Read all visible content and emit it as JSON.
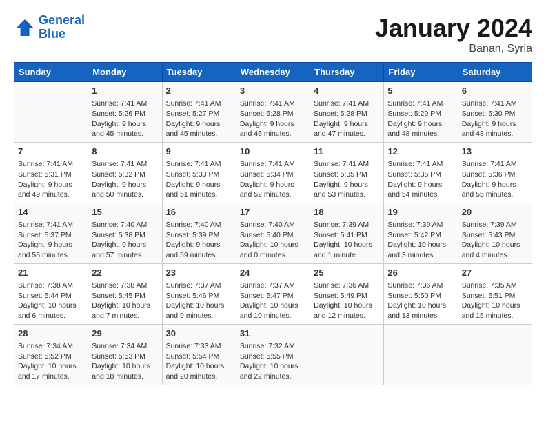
{
  "header": {
    "logo_line1": "General",
    "logo_line2": "Blue",
    "month": "January 2024",
    "location": "Banan, Syria"
  },
  "weekdays": [
    "Sunday",
    "Monday",
    "Tuesday",
    "Wednesday",
    "Thursday",
    "Friday",
    "Saturday"
  ],
  "weeks": [
    [
      {
        "day": "",
        "info": ""
      },
      {
        "day": "1",
        "info": "Sunrise: 7:41 AM\nSunset: 5:26 PM\nDaylight: 9 hours\nand 45 minutes."
      },
      {
        "day": "2",
        "info": "Sunrise: 7:41 AM\nSunset: 5:27 PM\nDaylight: 9 hours\nand 45 minutes."
      },
      {
        "day": "3",
        "info": "Sunrise: 7:41 AM\nSunset: 5:28 PM\nDaylight: 9 hours\nand 46 minutes."
      },
      {
        "day": "4",
        "info": "Sunrise: 7:41 AM\nSunset: 5:28 PM\nDaylight: 9 hours\nand 47 minutes."
      },
      {
        "day": "5",
        "info": "Sunrise: 7:41 AM\nSunset: 5:29 PM\nDaylight: 9 hours\nand 48 minutes."
      },
      {
        "day": "6",
        "info": "Sunrise: 7:41 AM\nSunset: 5:30 PM\nDaylight: 9 hours\nand 48 minutes."
      }
    ],
    [
      {
        "day": "7",
        "info": "Sunrise: 7:41 AM\nSunset: 5:31 PM\nDaylight: 9 hours\nand 49 minutes."
      },
      {
        "day": "8",
        "info": "Sunrise: 7:41 AM\nSunset: 5:32 PM\nDaylight: 9 hours\nand 50 minutes."
      },
      {
        "day": "9",
        "info": "Sunrise: 7:41 AM\nSunset: 5:33 PM\nDaylight: 9 hours\nand 51 minutes."
      },
      {
        "day": "10",
        "info": "Sunrise: 7:41 AM\nSunset: 5:34 PM\nDaylight: 9 hours\nand 52 minutes."
      },
      {
        "day": "11",
        "info": "Sunrise: 7:41 AM\nSunset: 5:35 PM\nDaylight: 9 hours\nand 53 minutes."
      },
      {
        "day": "12",
        "info": "Sunrise: 7:41 AM\nSunset: 5:35 PM\nDaylight: 9 hours\nand 54 minutes."
      },
      {
        "day": "13",
        "info": "Sunrise: 7:41 AM\nSunset: 5:36 PM\nDaylight: 9 hours\nand 55 minutes."
      }
    ],
    [
      {
        "day": "14",
        "info": "Sunrise: 7:41 AM\nSunset: 5:37 PM\nDaylight: 9 hours\nand 56 minutes."
      },
      {
        "day": "15",
        "info": "Sunrise: 7:40 AM\nSunset: 5:38 PM\nDaylight: 9 hours\nand 57 minutes."
      },
      {
        "day": "16",
        "info": "Sunrise: 7:40 AM\nSunset: 5:39 PM\nDaylight: 9 hours\nand 59 minutes."
      },
      {
        "day": "17",
        "info": "Sunrise: 7:40 AM\nSunset: 5:40 PM\nDaylight: 10 hours\nand 0 minutes."
      },
      {
        "day": "18",
        "info": "Sunrise: 7:39 AM\nSunset: 5:41 PM\nDaylight: 10 hours\nand 1 minute."
      },
      {
        "day": "19",
        "info": "Sunrise: 7:39 AM\nSunset: 5:42 PM\nDaylight: 10 hours\nand 3 minutes."
      },
      {
        "day": "20",
        "info": "Sunrise: 7:39 AM\nSunset: 5:43 PM\nDaylight: 10 hours\nand 4 minutes."
      }
    ],
    [
      {
        "day": "21",
        "info": "Sunrise: 7:38 AM\nSunset: 5:44 PM\nDaylight: 10 hours\nand 6 minutes."
      },
      {
        "day": "22",
        "info": "Sunrise: 7:38 AM\nSunset: 5:45 PM\nDaylight: 10 hours\nand 7 minutes."
      },
      {
        "day": "23",
        "info": "Sunrise: 7:37 AM\nSunset: 5:46 PM\nDaylight: 10 hours\nand 9 minutes."
      },
      {
        "day": "24",
        "info": "Sunrise: 7:37 AM\nSunset: 5:47 PM\nDaylight: 10 hours\nand 10 minutes."
      },
      {
        "day": "25",
        "info": "Sunrise: 7:36 AM\nSunset: 5:49 PM\nDaylight: 10 hours\nand 12 minutes."
      },
      {
        "day": "26",
        "info": "Sunrise: 7:36 AM\nSunset: 5:50 PM\nDaylight: 10 hours\nand 13 minutes."
      },
      {
        "day": "27",
        "info": "Sunrise: 7:35 AM\nSunset: 5:51 PM\nDaylight: 10 hours\nand 15 minutes."
      }
    ],
    [
      {
        "day": "28",
        "info": "Sunrise: 7:34 AM\nSunset: 5:52 PM\nDaylight: 10 hours\nand 17 minutes."
      },
      {
        "day": "29",
        "info": "Sunrise: 7:34 AM\nSunset: 5:53 PM\nDaylight: 10 hours\nand 18 minutes."
      },
      {
        "day": "30",
        "info": "Sunrise: 7:33 AM\nSunset: 5:54 PM\nDaylight: 10 hours\nand 20 minutes."
      },
      {
        "day": "31",
        "info": "Sunrise: 7:32 AM\nSunset: 5:55 PM\nDaylight: 10 hours\nand 22 minutes."
      },
      {
        "day": "",
        "info": ""
      },
      {
        "day": "",
        "info": ""
      },
      {
        "day": "",
        "info": ""
      }
    ]
  ]
}
